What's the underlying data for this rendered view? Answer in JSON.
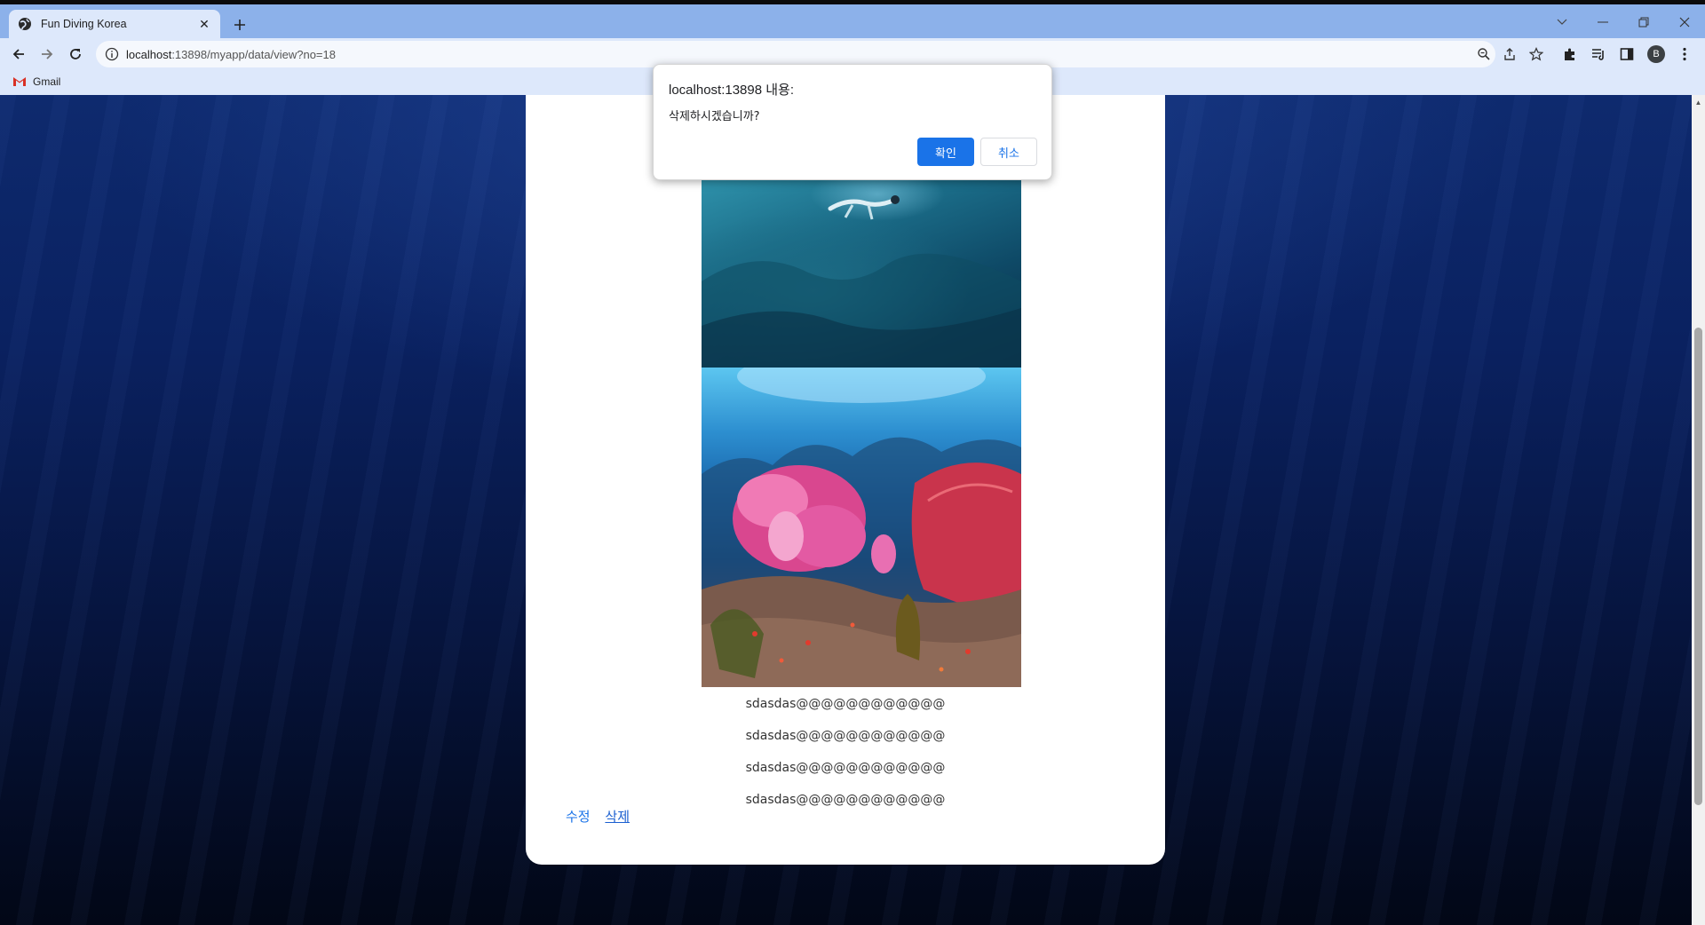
{
  "browser": {
    "tab_title": "Fun Diving Korea",
    "url_host": "localhost",
    "url_path": ":13898/myapp/data/view?no=18",
    "bookmark_label": "Gmail",
    "profile_initial": "B"
  },
  "page": {
    "text_lines": [
      "sdasdas@@@@@@@@@@@@",
      "sdasdas@@@@@@@@@@@@",
      "sdasdas@@@@@@@@@@@@",
      "sdasdas@@@@@@@@@@@@"
    ],
    "edit_label": "수정",
    "delete_label": "삭제"
  },
  "dialog": {
    "title": "localhost:13898 내용:",
    "message": "삭제하시겠습니까?",
    "ok_label": "확인",
    "cancel_label": "취소"
  },
  "colors": {
    "accent": "#1a73e8",
    "tabbar": "#8cb1ea",
    "toolbar": "#dde8fb"
  }
}
